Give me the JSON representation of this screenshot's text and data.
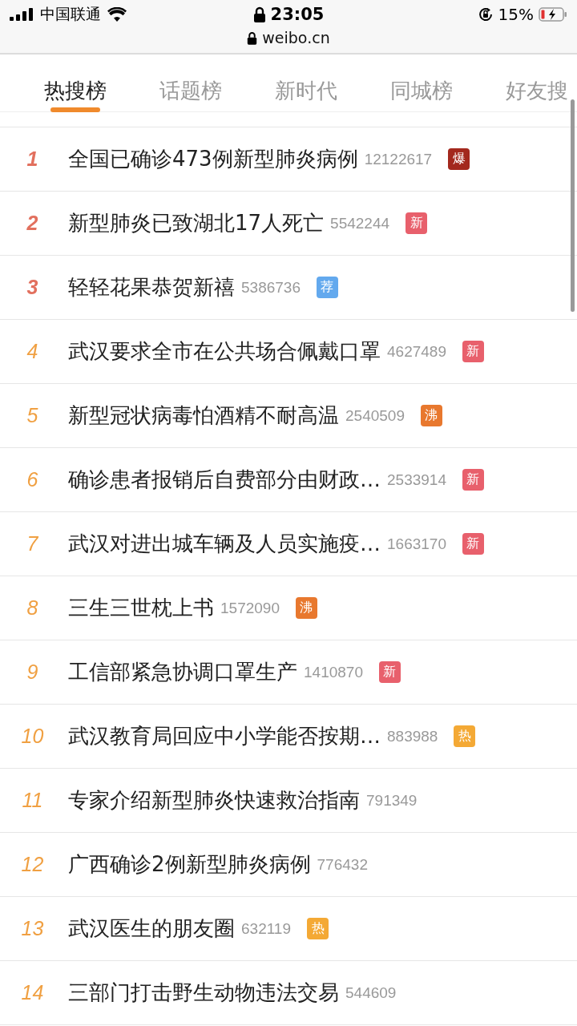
{
  "status_bar": {
    "carrier": "中国联通",
    "time": "23:05",
    "battery": "15%"
  },
  "address_bar": {
    "url": "weibo.cn"
  },
  "tabs": [
    {
      "label": "热搜榜",
      "selected": true
    },
    {
      "label": "话题榜",
      "selected": false
    },
    {
      "label": "新时代",
      "selected": false
    },
    {
      "label": "同城榜",
      "selected": false
    },
    {
      "label": "好友搜",
      "selected": false
    }
  ],
  "rows": [
    {
      "rank": "1",
      "title": "全国已确诊473例新型肺炎病例",
      "count": "12122617",
      "badge": {
        "label": "爆",
        "color": "#a3281d"
      }
    },
    {
      "rank": "2",
      "title": "新型肺炎已致湖北17人死亡",
      "count": "5542244",
      "badge": {
        "label": "新",
        "color": "#e8606c"
      }
    },
    {
      "rank": "3",
      "title": "轻轻花果恭贺新禧",
      "count": "5386736",
      "badge": {
        "label": "荐",
        "color": "#63a9ee"
      }
    },
    {
      "rank": "4",
      "title": "武汉要求全市在公共场合佩戴口罩",
      "count": "4627489",
      "badge": {
        "label": "新",
        "color": "#e8606c"
      }
    },
    {
      "rank": "5",
      "title": "新型冠状病毒怕酒精不耐高温",
      "count": "2540509",
      "badge": {
        "label": "沸",
        "color": "#e8782e"
      }
    },
    {
      "rank": "6",
      "title": "确诊患者报销后自费部分由财政…",
      "count": "2533914",
      "badge": {
        "label": "新",
        "color": "#e8606c"
      }
    },
    {
      "rank": "7",
      "title": "武汉对进出城车辆及人员实施疫…",
      "count": "1663170",
      "badge": {
        "label": "新",
        "color": "#e8606c"
      }
    },
    {
      "rank": "8",
      "title": "三生三世枕上书",
      "count": "1572090",
      "badge": {
        "label": "沸",
        "color": "#e8782e"
      }
    },
    {
      "rank": "9",
      "title": "工信部紧急协调口罩生产",
      "count": "1410870",
      "badge": {
        "label": "新",
        "color": "#e8606c"
      }
    },
    {
      "rank": "10",
      "title": "武汉教育局回应中小学能否按期…",
      "count": "883988",
      "badge": {
        "label": "热",
        "color": "#f4a935"
      }
    },
    {
      "rank": "11",
      "title": "专家介绍新型肺炎快速救治指南",
      "count": "791349"
    },
    {
      "rank": "12",
      "title": "广西确诊2例新型肺炎病例",
      "count": "776432"
    },
    {
      "rank": "13",
      "title": "武汉医生的朋友圈",
      "count": "632119",
      "badge": {
        "label": "热",
        "color": "#f4a935"
      }
    },
    {
      "rank": "14",
      "title": "三部门打击野生动物违法交易",
      "count": "544609"
    }
  ]
}
